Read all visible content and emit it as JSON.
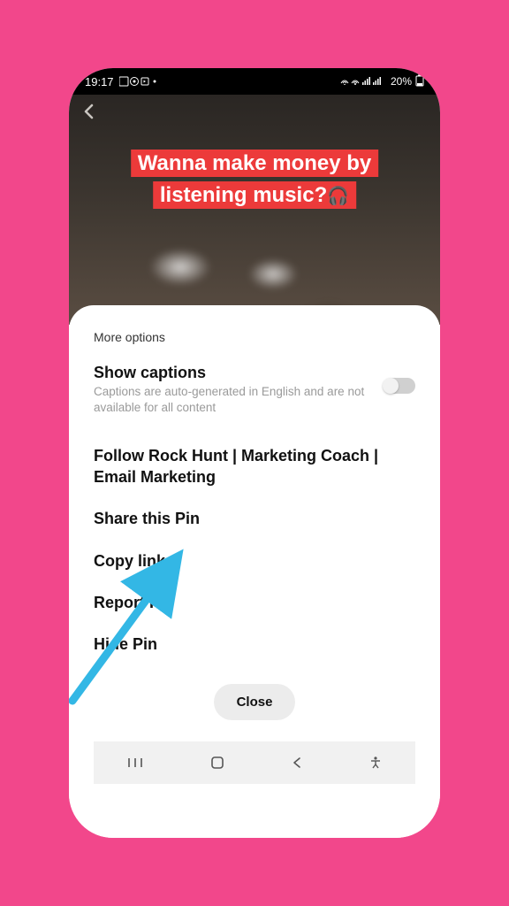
{
  "status": {
    "time": "19:17",
    "left_icons": "▢ ⊙ ▸ •",
    "right_icons": "�令 ᯤ .ıl .ıl",
    "battery": "20%",
    "battery_icon": "▮"
  },
  "pin": {
    "caption_line1": "Wanna make money by",
    "caption_line2": "listening music?",
    "headphone_emoji": "🎧"
  },
  "sheet": {
    "title": "More options",
    "captions": {
      "label": "Show captions",
      "sub": "Captions are auto-generated in English and are not available for all content"
    },
    "items": {
      "follow": "Follow Rock Hunt | Marketing Coach | Email Marketing",
      "share": "Share this Pin",
      "copy": "Copy link",
      "report": "Report Pin",
      "hide": "Hide Pin"
    },
    "close": "Close"
  },
  "nav": {
    "recents": "|||",
    "home": "▢",
    "back": "<",
    "accessibility": "✶"
  }
}
